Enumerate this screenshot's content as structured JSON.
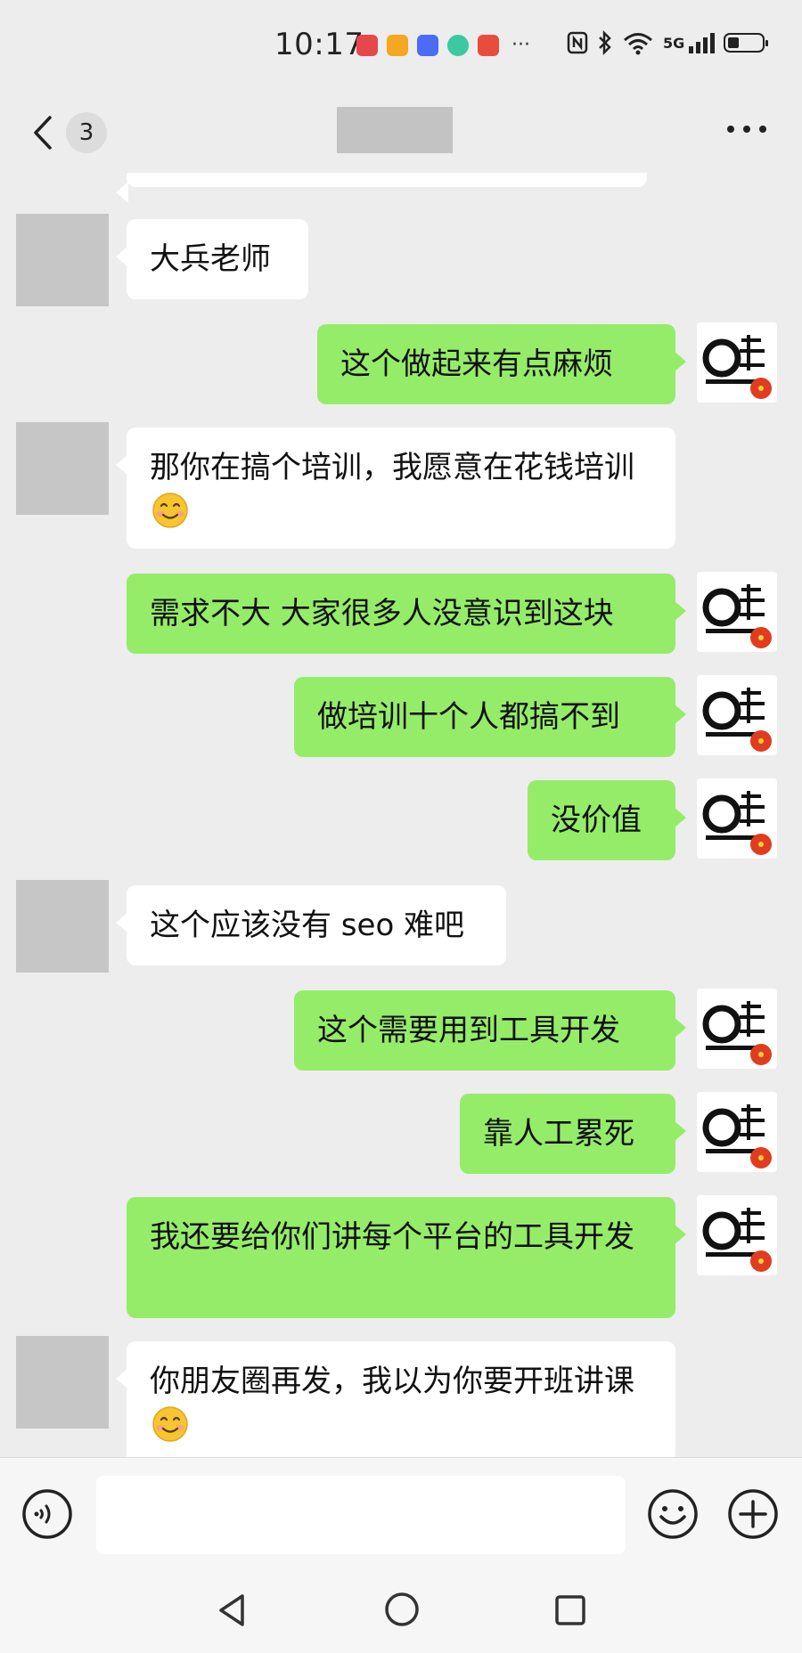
{
  "status_bar": {
    "time": "10:17",
    "notification_icons": [
      {
        "name": "huawei-app-icon",
        "color": "#e5474b"
      },
      {
        "name": "weibo-icon",
        "color": "#f5a623"
      },
      {
        "name": "tieba-icon",
        "color": "#4a6cf7"
      },
      {
        "name": "qq-browser-icon",
        "color": "#3cc8a0"
      },
      {
        "name": "book-app-icon",
        "color": "#e84c3d"
      }
    ],
    "more": "···",
    "network_label": "5G"
  },
  "header": {
    "unread_count": "3"
  },
  "messages": [
    {
      "side": "left",
      "text": "大兵老师",
      "emoji": false
    },
    {
      "side": "right",
      "text": "这个做起来有点麻烦",
      "emoji": false
    },
    {
      "side": "left",
      "text": "那你在搞个培训，我愿意在花钱培训",
      "emoji": true
    },
    {
      "side": "right",
      "text": "需求不大 大家很多人没意识到这块",
      "emoji": false
    },
    {
      "side": "right",
      "text": "做培训十个人都搞不到",
      "emoji": false
    },
    {
      "side": "right",
      "text": "没价值",
      "emoji": false
    },
    {
      "side": "left",
      "text": "这个应该没有 seo 难吧",
      "emoji": false
    },
    {
      "side": "right",
      "text": "这个需要用到工具开发",
      "emoji": false
    },
    {
      "side": "right",
      "text": "靠人工累死",
      "emoji": false
    },
    {
      "side": "right",
      "text": "我还要给你们讲每个平台的工具开发",
      "emoji": false
    },
    {
      "side": "left",
      "text": "你朋友圈再发，我以为你要开班讲课",
      "emoji": true
    }
  ],
  "colors": {
    "background": "#ededed",
    "right_bubble": "#95ec69",
    "left_bubble": "#ffffff"
  },
  "icons": {
    "back": "chevron-left-icon",
    "more": "more-dots-icon",
    "voice": "voice-icon",
    "emoji": "emoji-icon",
    "plus": "plus-icon"
  }
}
